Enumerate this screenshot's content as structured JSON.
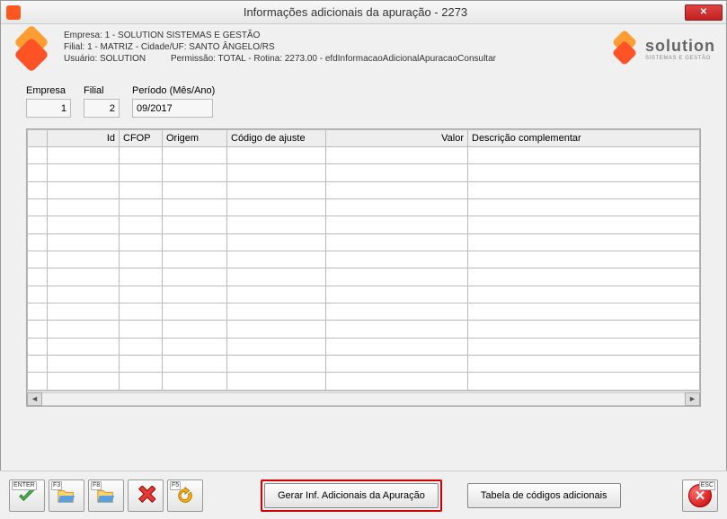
{
  "window": {
    "title": "Informações adicionais da apuração - 2273"
  },
  "header": {
    "line1": "Empresa: 1 - SOLUTION SISTEMAS E GESTÃO",
    "line2": "Filial: 1 - MATRIZ - Cidade/UF: SANTO ÂNGELO/RS",
    "line3_user": "Usuário: SOLUTION",
    "line3_perm": "Permissão: TOTAL - Rotina: 2273.00 - efdInformacaoAdicionalApuracaoConsultar",
    "brand_big": "solution",
    "brand_small": "SISTEMAS E GESTÃO"
  },
  "filters": {
    "empresa_label": "Empresa",
    "empresa_value": "1",
    "filial_label": "Filial",
    "filial_value": "2",
    "periodo_label": "Período (Mês/Ano)",
    "periodo_value": "09/2017"
  },
  "grid": {
    "columns": {
      "id": "Id",
      "cfop": "CFOP",
      "origem": "Origem",
      "codigo_ajuste": "Código de ajuste",
      "valor": "Valor",
      "descricao": "Descrição complementar"
    },
    "rows": []
  },
  "footer": {
    "enter_key": "ENTER",
    "f3_key": "F3",
    "f8_key": "F8",
    "f5_key": "F5",
    "esc_key": "ESC",
    "primary_btn": "Gerar Inf. Adicionais da Apuração",
    "secondary_btn": "Tabela de códigos adicionais"
  }
}
